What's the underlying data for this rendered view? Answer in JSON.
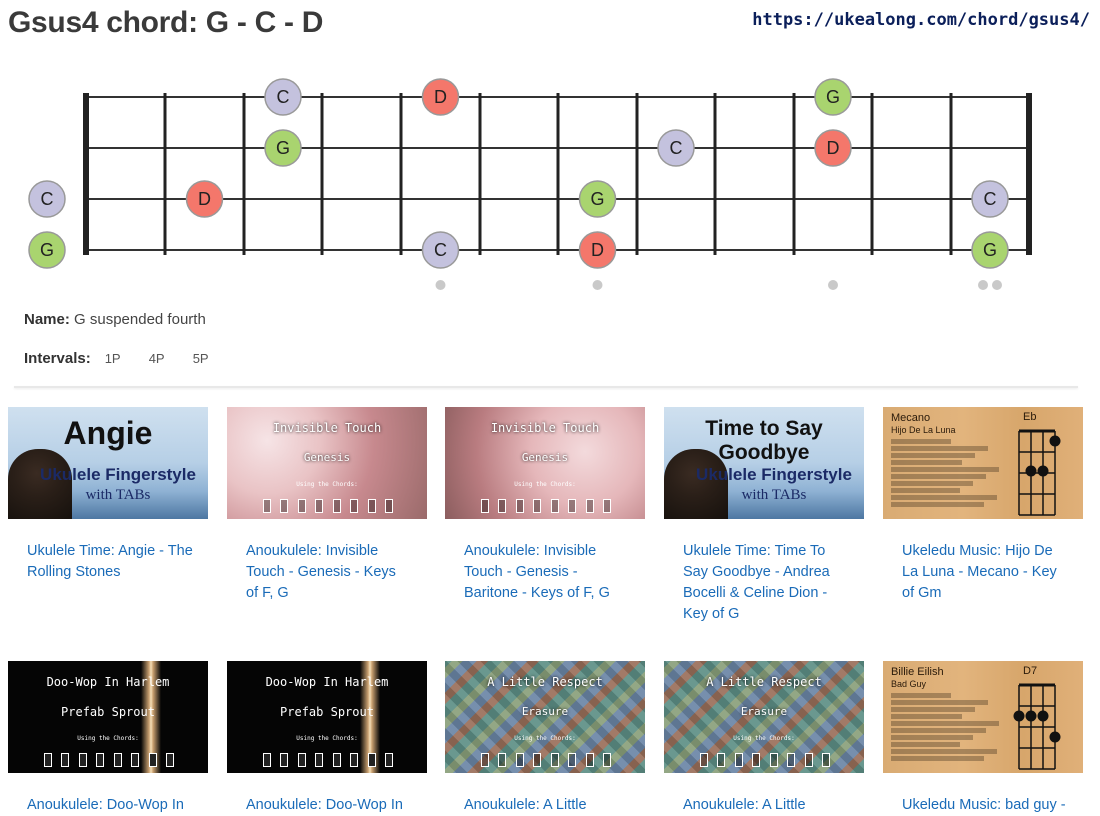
{
  "page": {
    "title": "Gsus4 chord: G - C - D",
    "url": "https://ukealong.com/chord/gsus4/"
  },
  "fretboard": {
    "string_count": 4,
    "fret_count": 12,
    "colors": {
      "C": "#c4c2de",
      "D": "#f4776b",
      "G": "#a9d46f"
    },
    "notes": [
      {
        "note": "C",
        "string": 1,
        "fret": 3
      },
      {
        "note": "D",
        "string": 1,
        "fret": 5
      },
      {
        "note": "G",
        "string": 1,
        "fret": 10
      },
      {
        "note": "G",
        "string": 2,
        "fret": 3
      },
      {
        "note": "C",
        "string": 2,
        "fret": 8
      },
      {
        "note": "D",
        "string": 2,
        "fret": 10
      },
      {
        "note": "C",
        "string": 3,
        "fret": 0
      },
      {
        "note": "D",
        "string": 3,
        "fret": 2
      },
      {
        "note": "G",
        "string": 3,
        "fret": 7
      },
      {
        "note": "C",
        "string": 3,
        "fret": 12
      },
      {
        "note": "G",
        "string": 4,
        "fret": 0
      },
      {
        "note": "C",
        "string": 4,
        "fret": 5
      },
      {
        "note": "D",
        "string": 4,
        "fret": 7
      },
      {
        "note": "G",
        "string": 4,
        "fret": 12
      }
    ],
    "inlays": [
      5,
      7,
      10,
      12
    ]
  },
  "info": {
    "name_label": "Name:",
    "name_value": "G suspended fourth",
    "intervals_label": "Intervals:",
    "intervals": [
      "1P",
      "4P",
      "5P"
    ]
  },
  "cards": [
    {
      "title": "Ukulele Time: Angie - The Rolling Stones",
      "thumb_type": "sky",
      "thumb_title": "Angie",
      "thumb_sub1": "Ukulele Fingerstyle",
      "thumb_sub2": "with TABs"
    },
    {
      "title": "Anoukulele: Invisible Touch - Genesis - Keys of F, G",
      "thumb_type": "blossom",
      "thumb_title": "Invisible Touch",
      "thumb_sub1": "Genesis",
      "thumb_sub2": "Using the Chords:"
    },
    {
      "title": "Anoukulele: Invisible Touch - Genesis - Baritone - Keys of F, G",
      "thumb_type": "blossom2",
      "thumb_title": "Invisible Touch",
      "thumb_sub1": "Genesis",
      "thumb_sub2": "Using the Chords:"
    },
    {
      "title": "Ukulele Time: Time To Say Goodbye - Andrea Bocelli & Celine Dion - Key of G",
      "thumb_type": "sky",
      "thumb_title": "Time to Say Goodbye",
      "thumb_sub1": "Ukulele Fingerstyle",
      "thumb_sub2": "with TABs"
    },
    {
      "title": "Ukeledu Music: Hijo De La Luna - Mecano - Key of Gm",
      "thumb_type": "wood",
      "thumb_title": "Mecano",
      "thumb_sub1": "Hijo De La Luna",
      "thumb_sub2": "Eb"
    },
    {
      "title": "Anoukulele: Doo-Wop In",
      "thumb_type": "dark",
      "thumb_title": "Doo-Wop In Harlem",
      "thumb_sub1": "Prefab Sprout",
      "thumb_sub2": "Using the Chords:"
    },
    {
      "title": "Anoukulele: Doo-Wop In",
      "thumb_type": "dark",
      "thumb_title": "Doo-Wop In Harlem",
      "thumb_sub1": "Prefab Sprout",
      "thumb_sub2": "Using the Chords:"
    },
    {
      "title": "Anoukulele: A Little",
      "thumb_type": "tiles",
      "thumb_title": "A Little Respect",
      "thumb_sub1": "Erasure",
      "thumb_sub2": "Using the Chords:"
    },
    {
      "title": "Anoukulele: A Little",
      "thumb_type": "tiles",
      "thumb_title": "A Little Respect",
      "thumb_sub1": "Erasure",
      "thumb_sub2": "Using the Chords:"
    },
    {
      "title": "Ukeledu Music: bad guy -",
      "thumb_type": "wood",
      "thumb_title": "Billie Eilish",
      "thumb_sub1": "Bad Guy",
      "thumb_sub2": "D7"
    }
  ]
}
